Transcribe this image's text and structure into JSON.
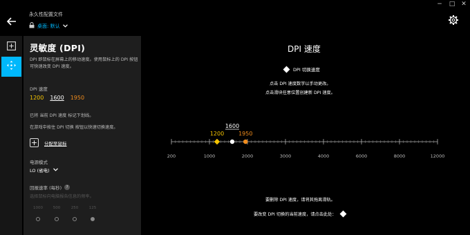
{
  "window": {
    "minimize": "−",
    "maximize": "□",
    "close": "✕"
  },
  "header": {
    "profile_title": "永久性配置文件",
    "profile_name": "桌面: 默认"
  },
  "panel": {
    "title": "灵敏度 (DPI)",
    "description": "DPI 即鼠标在屏幕上的移动速度。使用鼠标上的 DPI 按钮可快速改变 DPI 速度。",
    "dpi_label": "DPI 速度",
    "dpi_values": [
      "1200",
      "1600",
      "1950"
    ],
    "current_note": "已将 当前 DPI 速度 标记下划线。",
    "switch_note": "在游戏中按住 DPI 切换 按钮以快速切换速度。",
    "assign_label": "分配至鼠标",
    "power_label": "电源模式",
    "power_value": "LO (省电)",
    "rate_label": "回报速率 (每秒)",
    "rate_help": "?",
    "rate_desc": "选择鼠标向电脑报告信息的频率。",
    "rates": [
      "1000",
      "500",
      "250",
      "125"
    ],
    "selected_rate": "125"
  },
  "main": {
    "title": "DPI 速度",
    "legend": "DPI 切换速度",
    "hint1": "点击 DPI 速度数字以手动更改。",
    "hint2": "点击滑块任意位置创建新 DPI 速度。",
    "remove_hint": "要删除 DPI 速度，请将其拖离滑轨。",
    "shift_hint": "要改变 DPI 切换的当前速度，请点击此处："
  },
  "colors": {
    "accent": "#00b8fc",
    "dpi1": "#f5c400",
    "dpi2": "#ffffff",
    "dpi3": "#f08c1c"
  },
  "chart_data": {
    "type": "scatter",
    "x_ticks": [
      200,
      1000,
      2000,
      3000,
      4000,
      6000,
      8000,
      12000
    ],
    "points": [
      {
        "label": "1200",
        "value": 1200,
        "marker": "diamond"
      },
      {
        "label": "1600",
        "value": 1600,
        "marker": "circle",
        "current": true
      },
      {
        "label": "1950",
        "value": 1950,
        "marker": "circle"
      }
    ]
  }
}
